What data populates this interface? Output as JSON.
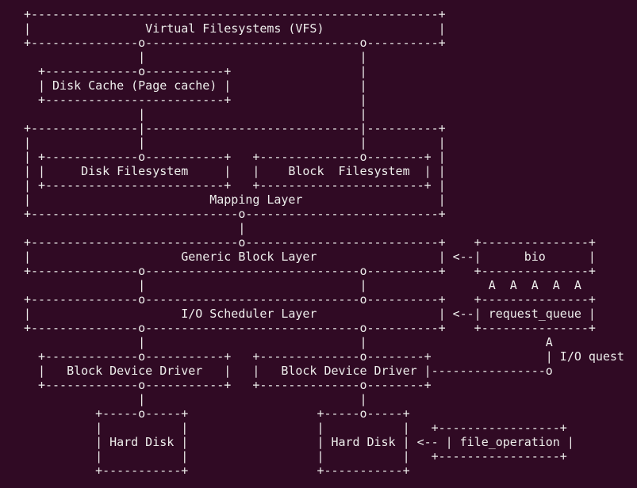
{
  "theme": {
    "background": "#300a24",
    "foreground": "#eeeeec"
  },
  "diagram": {
    "lines": [
      "+---------------------------------------------------------+",
      "|                Virtual Filesystems (VFS)                |",
      "+---------------o------------------------------o----------+",
      "                |                              |",
      "  +-------------o-----------+                  |",
      "  | Disk Cache (Page cache) |                  |",
      "  +-------------------------+                  |",
      "                |                              |",
      "+---------------|------------------------------|----------+",
      "|               |                              |          |",
      "| +-------------o-----------+   +--------------o--------+ |",
      "| |     Disk Filesystem     |   |    Block  Filesystem  | |",
      "| +-------------------------+   +-----------------------+ |",
      "|                         Mapping Layer                   |",
      "+-----------------------------o---------------------------+",
      "                              |",
      "+-----------------------------o---------------------------+    +---------------+",
      "|                     Generic Block Layer                 | <--|      bio      |",
      "+---------------o------------------------------o----------+    +---------------+",
      "                |                              |                 A  A  A  A  A",
      "+---------------o------------------------------o----------+    +---------------+",
      "|                     I/O Scheduler Layer                 | <--| request_queue |",
      "+---------------o------------------------------o----------+    +---------------+",
      "                |                              |                         A",
      "  +-------------o-----------+   +--------------o--------+                | I/O quest",
      "  |   Block Device Driver   |   |   Block Device Driver |----------------o",
      "  +-------------o-----------+   +--------------o--------+",
      "                |                              |",
      "          +-----o-----+                  +-----o-----+",
      "          |           |                  |           |   +-----------------+",
      "          | Hard Disk |                  | Hard Disk | <-- | file_operation |",
      "          |           |                  |           |   +-----------------+",
      "          +-----------+                  +-----------+"
    ]
  }
}
